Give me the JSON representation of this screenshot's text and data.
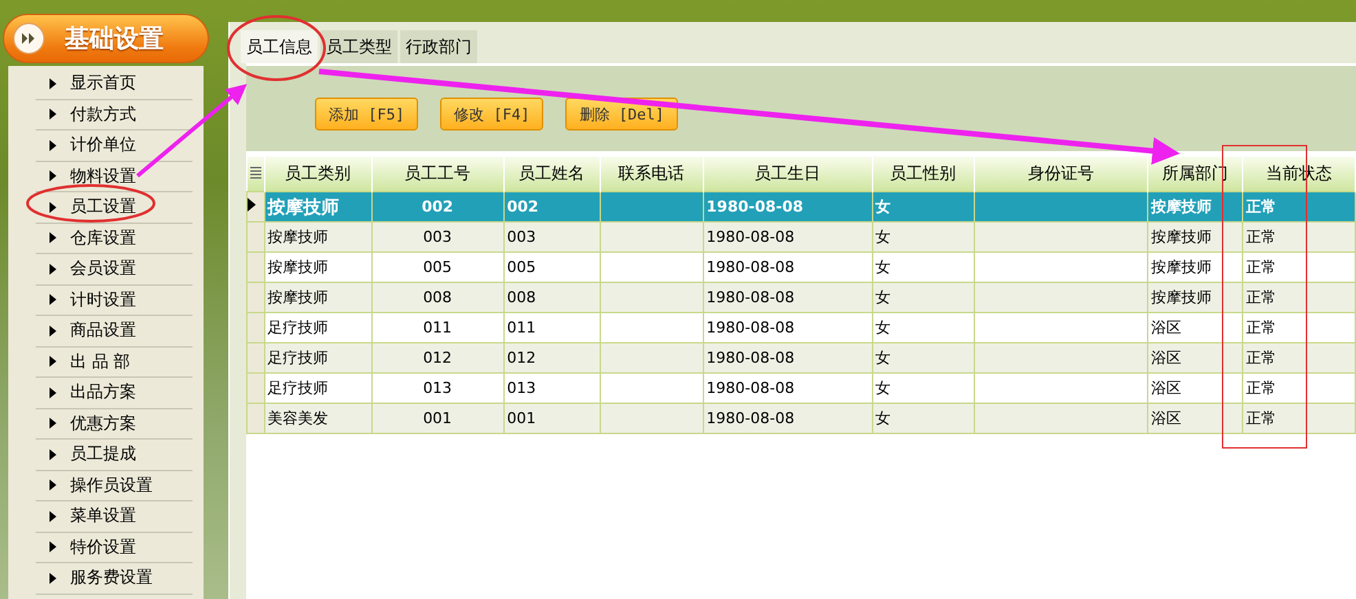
{
  "sidebar": {
    "title": "基础设置",
    "items": [
      {
        "label": "显示首页"
      },
      {
        "label": "付款方式"
      },
      {
        "label": "计价单位"
      },
      {
        "label": "物料设置"
      },
      {
        "label": "员工设置"
      },
      {
        "label": "仓库设置"
      },
      {
        "label": "会员设置"
      },
      {
        "label": "计时设置"
      },
      {
        "label": "商品设置"
      },
      {
        "label": "出 品 部"
      },
      {
        "label": "出品方案"
      },
      {
        "label": "优惠方案"
      },
      {
        "label": "员工提成"
      },
      {
        "label": "操作员设置"
      },
      {
        "label": "菜单设置"
      },
      {
        "label": "特价设置"
      },
      {
        "label": "服务费设置"
      }
    ]
  },
  "tabs": [
    {
      "label": "员工信息",
      "selected": true
    },
    {
      "label": "员工类型",
      "selected": false
    },
    {
      "label": "行政部门",
      "selected": false
    }
  ],
  "toolbar": {
    "buttons": [
      "添加 [F5]",
      "修改 [F4]",
      "删除 [Del]"
    ]
  },
  "table": {
    "columns": [
      "员工类别",
      "员工工号",
      "员工姓名",
      "联系电话",
      "员工生日",
      "员工性别",
      "身份证号",
      "所属部门",
      "当前状态"
    ],
    "rows": [
      {
        "selected": true,
        "cells": [
          "按摩技师",
          "002",
          "002",
          "",
          "1980-08-08",
          "女",
          "",
          "按摩技师",
          "正常"
        ]
      },
      {
        "selected": false,
        "cells": [
          "按摩技师",
          "003",
          "003",
          "",
          "1980-08-08",
          "女",
          "",
          "按摩技师",
          "正常"
        ]
      },
      {
        "selected": false,
        "cells": [
          "按摩技师",
          "005",
          "005",
          "",
          "1980-08-08",
          "女",
          "",
          "按摩技师",
          "正常"
        ]
      },
      {
        "selected": false,
        "cells": [
          "按摩技师",
          "008",
          "008",
          "",
          "1980-08-08",
          "女",
          "",
          "按摩技师",
          "正常"
        ]
      },
      {
        "selected": false,
        "cells": [
          "足疗技师",
          "011",
          "011",
          "",
          "1980-08-08",
          "女",
          "",
          "浴区",
          "正常"
        ]
      },
      {
        "selected": false,
        "cells": [
          "足疗技师",
          "012",
          "012",
          "",
          "1980-08-08",
          "女",
          "",
          "浴区",
          "正常"
        ]
      },
      {
        "selected": false,
        "cells": [
          "足疗技师",
          "013",
          "013",
          "",
          "1980-08-08",
          "女",
          "",
          "浴区",
          "正常"
        ]
      },
      {
        "selected": false,
        "cells": [
          "美容美发",
          "001",
          "001",
          "",
          "1980-08-08",
          "女",
          "",
          "浴区",
          "正常"
        ]
      }
    ]
  }
}
